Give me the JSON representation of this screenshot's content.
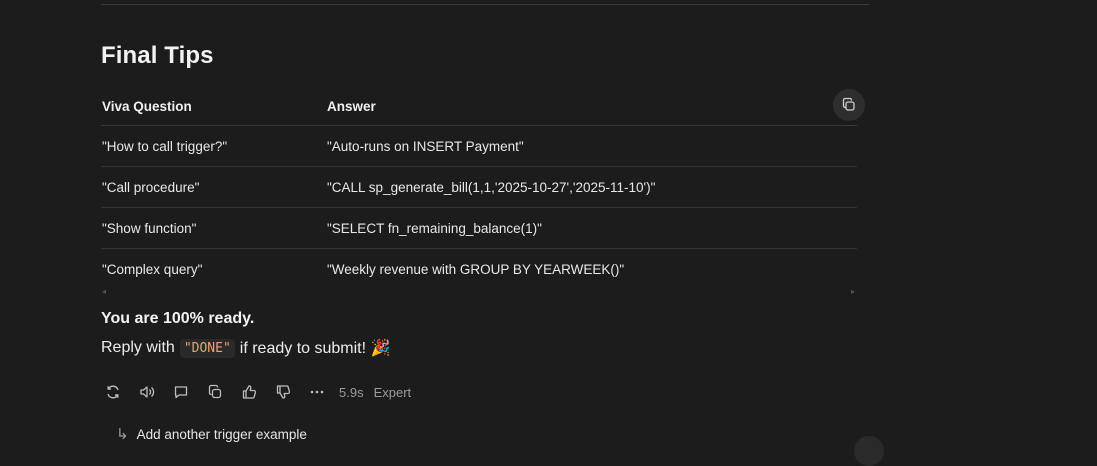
{
  "section": {
    "heading": "Final Tips"
  },
  "table": {
    "headers": [
      "Viva Question",
      "Answer"
    ],
    "rows": [
      [
        "\"How to call trigger?\"",
        "\"Auto-runs on INSERT Payment\""
      ],
      [
        "\"Call procedure\"",
        "\"CALL sp_generate_bill(1,1,'2025-10-27','2025-11-10')\""
      ],
      [
        "\"Show function\"",
        "\"SELECT fn_remaining_balance(1)\""
      ],
      [
        "\"Complex query\"",
        "\"Weekly revenue with GROUP BY YEARWEEK()\""
      ]
    ]
  },
  "message": {
    "ready_text": "You are 100% ready.",
    "reply_prefix": "Reply with",
    "reply_code": "\"DONE\"",
    "reply_suffix": "if ready to submit! 🎉"
  },
  "toolbar": {
    "icons": [
      "regenerate-icon",
      "read-aloud-icon",
      "comment-icon",
      "copy-icon",
      "thumbs-up-icon",
      "thumbs-down-icon",
      "more-icon"
    ],
    "time": "5.9s",
    "mode": "Expert"
  },
  "followup": {
    "label": "Add another trigger example"
  }
}
